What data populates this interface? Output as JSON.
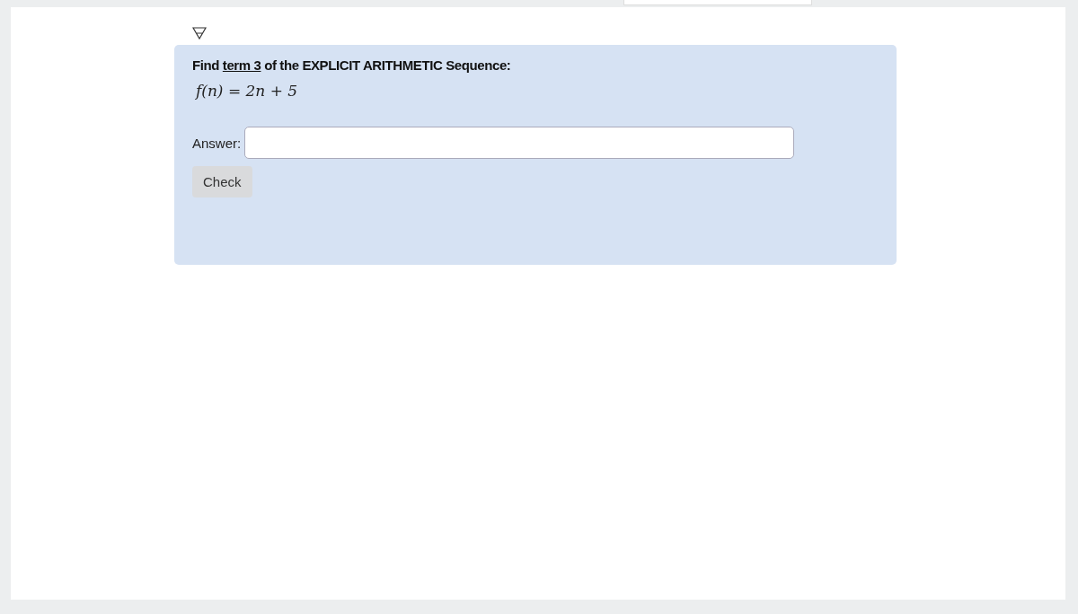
{
  "question": {
    "prefix": "Find ",
    "link": "term 3",
    "suffix": " of the EXPLICIT ARITHMETIC Sequence:"
  },
  "formula": "f(n) = 2n + 5",
  "answer": {
    "label": "Answer:"
  },
  "buttons": [
    "Check"
  ]
}
